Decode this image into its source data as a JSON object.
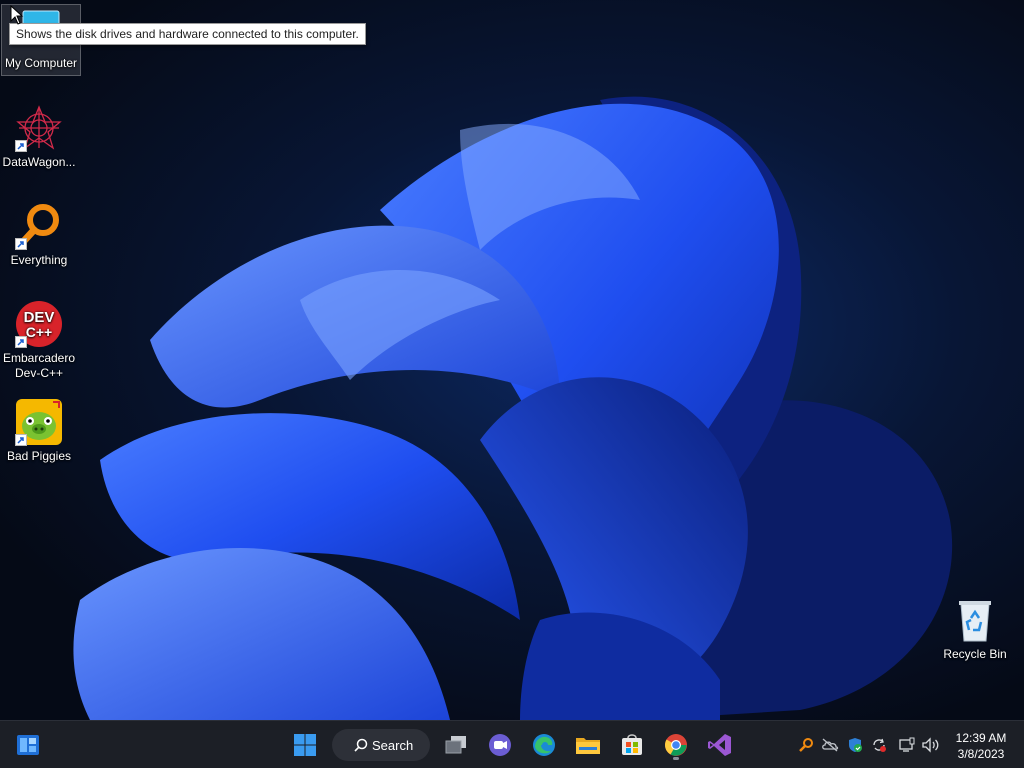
{
  "desktop": {
    "icons": [
      {
        "label": "My Computer",
        "icon": "monitor-icon"
      },
      {
        "label": "DataWagon...",
        "icon": "datawagon-icon"
      },
      {
        "label": "Everything",
        "icon": "everything-search-icon"
      },
      {
        "label": "Embarcadero Dev-C++",
        "icon": "devcpp-icon",
        "logo_text": "DEV C++"
      },
      {
        "label": "Bad Piggies",
        "icon": "bad-piggies-icon"
      },
      {
        "label": "Recycle Bin",
        "icon": "recycle-bin-icon"
      }
    ],
    "tooltip": "Shows the disk drives and hardware connected to this computer."
  },
  "taskbar": {
    "search_label": "Search",
    "pinned": [
      {
        "name": "start",
        "icon": "windows-logo-icon"
      },
      {
        "name": "task-view",
        "icon": "task-view-icon"
      },
      {
        "name": "teams-chat",
        "icon": "teams-icon"
      },
      {
        "name": "edge",
        "icon": "edge-icon"
      },
      {
        "name": "file-explorer",
        "icon": "folder-icon"
      },
      {
        "name": "microsoft-store",
        "icon": "store-icon"
      },
      {
        "name": "chrome",
        "icon": "chrome-icon"
      },
      {
        "name": "visual-studio",
        "icon": "visual-studio-icon"
      }
    ],
    "tray_icons": [
      "everything-tray-icon",
      "onedrive-offline-icon",
      "defender-icon",
      "sync-icon",
      "display-icon",
      "volume-icon"
    ],
    "clock": {
      "time": "12:39 AM",
      "date": "3/8/2023"
    }
  },
  "colors": {
    "taskbar": "#1c1f26",
    "wallpaper_blue": "#1f4ef0",
    "accent": "#3a9bf0"
  }
}
